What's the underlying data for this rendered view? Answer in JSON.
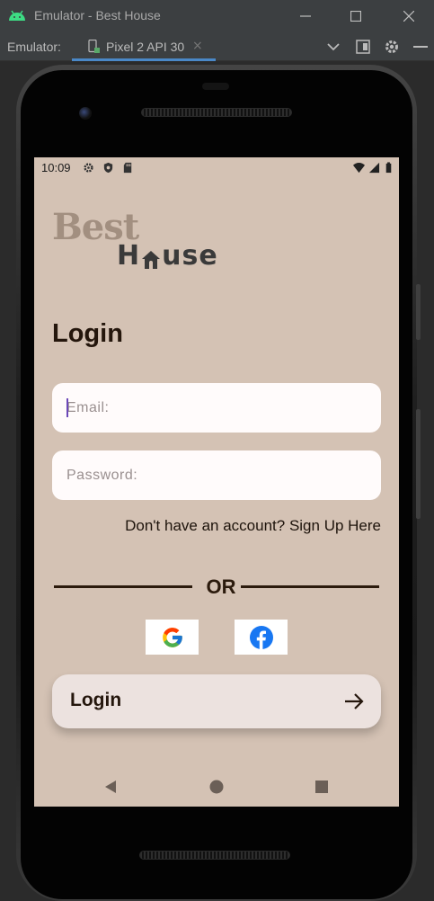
{
  "window": {
    "title": "Emulator - Best House",
    "minimize_icon": "minimize-icon",
    "maximize_icon": "maximize-icon",
    "close_icon": "close-icon"
  },
  "tabstrip": {
    "label": "Emulator:",
    "active_tab": "Pixel 2 API 30",
    "close_glyph": "×"
  },
  "status_bar": {
    "time": "10:09",
    "icons": [
      "settings-icon",
      "shield-icon",
      "sd-card-icon",
      "wifi-icon",
      "signal-icon",
      "battery-icon"
    ]
  },
  "logo": {
    "word1": "Best",
    "word2_left": "H",
    "word2_right": "use"
  },
  "form": {
    "heading": "Login",
    "email_placeholder": "Email:",
    "password_placeholder": "Password:",
    "signup_link": "Don't have an account? Sign Up Here",
    "divider_text": "OR",
    "login_button": "Login"
  },
  "colors": {
    "screen_bg": "#d4c2b4",
    "text_dark": "#24160c",
    "logo_best": "#a28f80",
    "logo_house": "#3a3a3a",
    "field_bg": "#fffbfb",
    "button_bg": "#ece2df",
    "facebook_blue": "#1877f2"
  }
}
